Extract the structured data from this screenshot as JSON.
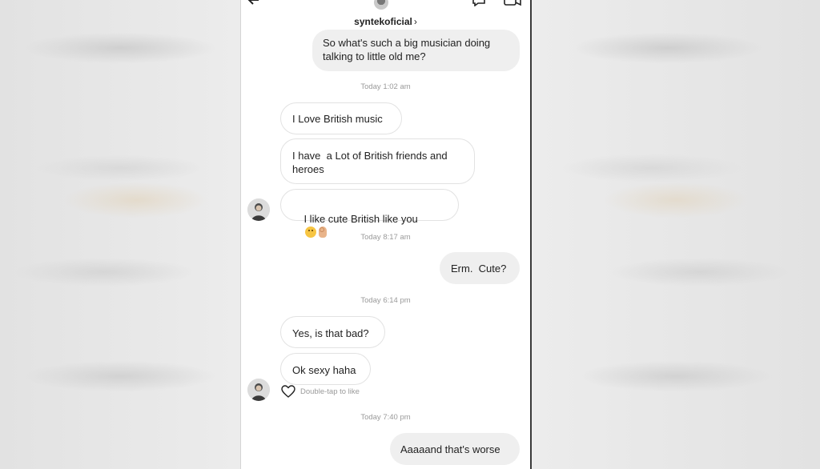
{
  "header": {
    "username": "syntekoficial",
    "chevron": "›"
  },
  "messages": {
    "m1": "So what's such a big musician doing\ntalking to little old me?",
    "t1": "Today 1:02 am",
    "m2": "I Love British music",
    "m3": "I have  a Lot of British friends and\nheroes",
    "m4": "I like cute British like you",
    "t2": "Today 8:17 am",
    "m5": "Erm.  Cute?",
    "t3": "Today 6:14 pm",
    "m6": "Yes, is that bad?",
    "m7": "Ok sexy haha",
    "like_hint": "Double-tap to like",
    "t4": "Today 7:40 pm",
    "m8": "Aaaaand that's worse"
  },
  "icons": {
    "back": "back-arrow-icon",
    "info": "info-icon",
    "video": "video-camera-icon",
    "heart": "heart-icon",
    "wink": "winking-face-emoji",
    "ok": "ok-hand-emoji"
  },
  "colors": {
    "outgoing_bubble": "#efefef",
    "incoming_border": "#e2e2e2",
    "timestamp": "#9a9a9a"
  }
}
